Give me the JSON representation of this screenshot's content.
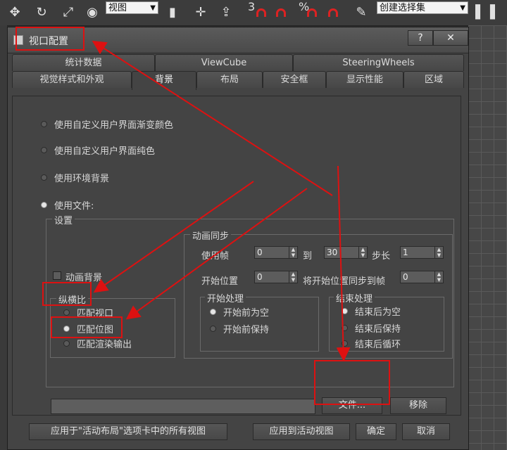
{
  "toolbar": {
    "view_select": "视图",
    "snap_3": "3",
    "snap_percent": "%",
    "selection_set_select": "创建选择集"
  },
  "dialog": {
    "title": "视口配置",
    "help_label": "?",
    "close_label": "✕",
    "tabs_row1": [
      "统计数据",
      "ViewCube",
      "SteeringWheels"
    ],
    "tabs_row2": [
      "视觉样式和外观",
      "背景",
      "布局",
      "安全框",
      "显示性能",
      "区域"
    ],
    "active_tab": "背景",
    "background_options": [
      {
        "label": "使用自定义用户界面渐变颜色",
        "selected": false
      },
      {
        "label": "使用自定义用户界面纯色",
        "selected": false
      },
      {
        "label": "使用环境背景",
        "selected": false
      },
      {
        "label": "使用文件:",
        "selected": true
      }
    ],
    "settings": {
      "group_label": "设置",
      "animate_bg_label": "动画背景",
      "aspect_label": "纵横比",
      "aspect_options": [
        {
          "label": "匹配视口",
          "selected": false
        },
        {
          "label": "匹配位图",
          "selected": true
        },
        {
          "label": "匹配渲染输出",
          "selected": false
        }
      ],
      "anim_sync": {
        "group_label": "动画同步",
        "use_frame_label": "使用帧",
        "from_value": "0",
        "to_label": "到",
        "to_value": "30",
        "step_label": "步长",
        "step_value": "1",
        "start_pos_label": "开始位置",
        "start_pos_value": "0",
        "sync_label": "将开始位置同步到帧",
        "sync_value": "0",
        "start_proc": {
          "group_label": "开始处理",
          "options": [
            {
              "label": "开始前为空",
              "selected": true
            },
            {
              "label": "开始前保持",
              "selected": false
            }
          ]
        },
        "end_proc": {
          "group_label": "结束处理",
          "options": [
            {
              "label": "结束后为空",
              "selected": true
            },
            {
              "label": "结束后保持",
              "selected": false
            },
            {
              "label": "结束后循环",
              "selected": false
            }
          ]
        }
      },
      "file_button": "文件...",
      "remove_button": "移除",
      "file_path": ""
    },
    "footer": {
      "apply_all": "应用于\"活动布局\"选项卡中的所有视图",
      "apply_active": "应用到活动视图",
      "ok": "确定",
      "cancel": "取消"
    }
  },
  "colors": {
    "annotation_red": "#dd1111"
  }
}
